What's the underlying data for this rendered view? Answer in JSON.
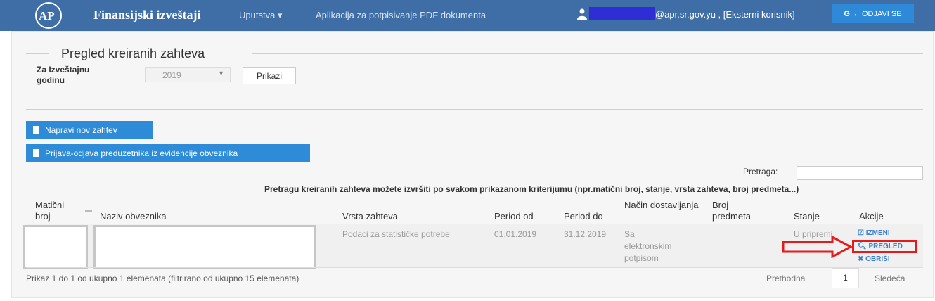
{
  "navbar": {
    "brand": "Finansijski izveštaji",
    "menu_uputstva": "Uputstva ▾",
    "menu_aplikacija": "Aplikacija za potpisivanje PDF dokumenta",
    "user_text": "@apr.sr.gov.yu , [Eksterni korisnik]",
    "logout_label": "ODJAVI SE",
    "bg_color": "#3f6ea7"
  },
  "filter": {
    "legend": "Pregled kreiranih zahteva",
    "year_label": "Za Izveštajnu godinu",
    "year_value": "2019",
    "show_button": "Prikazi"
  },
  "actions": {
    "new_request": "Napravi nov zahtev",
    "register": "Prijava-odjava preduzetnika iz evidencije obveznika"
  },
  "search": {
    "label": "Pretraga:",
    "value": "",
    "hint": "Pretragu kreiranih zahteva možete izvršiti po svakom prikazanom kriterijumu (npr.matični broj, stanje, vrsta zahteva, broj predmeta...)"
  },
  "table": {
    "headers": {
      "maticni": "Matični broj",
      "naziv": "Naziv obveznika",
      "vrsta": "Vrsta zahteva",
      "period_od": "Period od",
      "period_do": "Period do",
      "nacin": "Način dostavljanja",
      "broj": "Broj predmeta",
      "stanje": "Stanje",
      "akcije": "Akcije"
    },
    "rows": [
      {
        "maticni": "",
        "naziv": "",
        "vrsta": "Podaci za statističke potrebe",
        "period_od": "01.01.2019",
        "period_do": "31.12.2019",
        "nacin": "Sa elektronskim potpisom",
        "broj": "",
        "stanje": "U pripremi",
        "actions": {
          "edit": "IZMENI",
          "view": "PREGLED",
          "delete": "OBRIŠI"
        }
      }
    ]
  },
  "pagination": {
    "info": "Prikaz 1 do 1 od ukupno 1 elemenata (filtrirano od ukupno 15 elemenata)",
    "prev": "Prethodna",
    "page": "1",
    "next": "Sledeća"
  },
  "colors": {
    "accent": "#2d8bd8",
    "highlight": "#e41b1b"
  }
}
